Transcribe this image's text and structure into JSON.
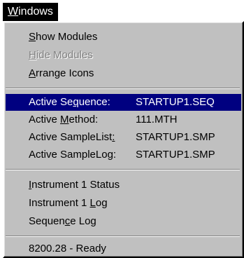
{
  "menubar": {
    "windows_label": "Windows",
    "windows_mnemonic": "W",
    "windows_rest": "indows"
  },
  "menu": {
    "view_items": [
      {
        "pre": "",
        "mn": "S",
        "post": "how Modules",
        "enabled": true
      },
      {
        "pre": "",
        "mn": "H",
        "post": "ide Modules",
        "enabled": false
      },
      {
        "pre": "",
        "mn": "A",
        "post": "rrange Icons",
        "enabled": true
      }
    ],
    "active_items": [
      {
        "pre": "Active Se",
        "mn": "q",
        "post": "uence:",
        "value": "STARTUP1.SEQ",
        "highlighted": true
      },
      {
        "pre": "Active ",
        "mn": "M",
        "post": "ethod:",
        "value": "111.MTH",
        "highlighted": false
      },
      {
        "pre": "Active SampleList",
        "mn": ":",
        "post": "",
        "value": "STARTUP1.SMP",
        "highlighted": false
      },
      {
        "pre": "Active SampleLo",
        "mn": "g",
        "post": ":",
        "value": "STARTUP1.SMP",
        "highlighted": false
      }
    ],
    "log_items": [
      {
        "pre": "",
        "mn": "I",
        "post": "nstrument 1 Status"
      },
      {
        "pre": "Instrument 1 ",
        "mn": "L",
        "post": "og"
      },
      {
        "pre": "Sequen",
        "mn": "c",
        "post": "e Log"
      }
    ],
    "status_item": {
      "label": "8200.28 - Ready"
    }
  },
  "colors": {
    "menu_bg": "#c0c0c0",
    "highlight_bg": "#000080",
    "highlight_fg": "#ffffff",
    "disabled_fg": "#808080",
    "menubar_bg": "#000000"
  }
}
